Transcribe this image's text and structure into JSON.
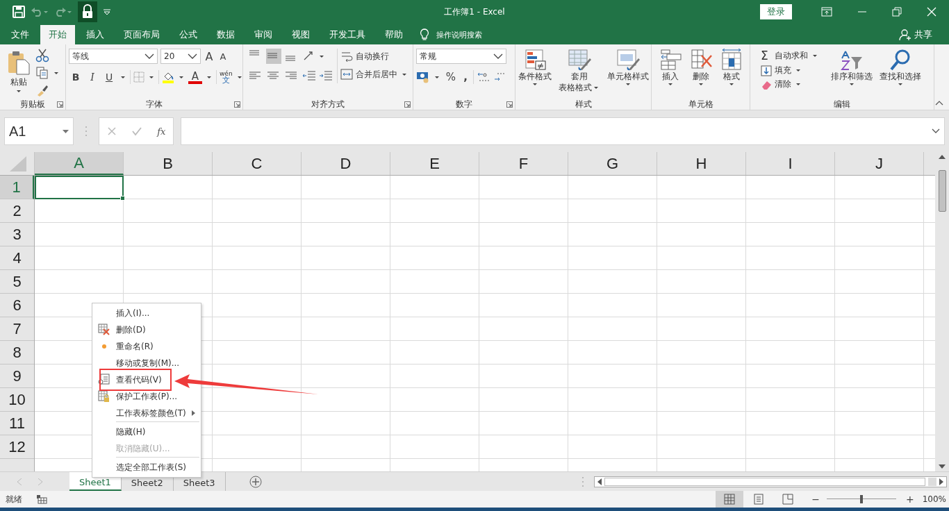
{
  "title_bar": {
    "title": "工作簿1  -  Excel",
    "login_button": "登录"
  },
  "ribbon_tabs": [
    {
      "label": "文件",
      "selected": false
    },
    {
      "label": "开始",
      "selected": true
    },
    {
      "label": "插入",
      "selected": false
    },
    {
      "label": "页面布局",
      "selected": false
    },
    {
      "label": "公式",
      "selected": false
    },
    {
      "label": "数据",
      "selected": false
    },
    {
      "label": "审阅",
      "selected": false
    },
    {
      "label": "视图",
      "selected": false
    },
    {
      "label": "开发工具",
      "selected": false
    },
    {
      "label": "帮助",
      "selected": false
    }
  ],
  "tell_me": "操作说明搜索",
  "share": "共享",
  "ribbon": {
    "clipboard": {
      "paste": "粘贴",
      "label": "剪贴板"
    },
    "font": {
      "font_name": "等线",
      "font_size": "20",
      "grow": "A",
      "shrink": "A",
      "bold": "B",
      "italic": "I",
      "underline": "U",
      "font_color": "A",
      "phonetic_top": "wén",
      "phonetic_bottom": "文",
      "label": "字体"
    },
    "alignment": {
      "vertical_align": [
        {
          "selected": false
        },
        {
          "selected": true
        },
        {
          "selected": false
        }
      ],
      "wrap_text": "自动换行",
      "merge_center": "合并后居中",
      "label": "对齐方式"
    },
    "number": {
      "format": "常规",
      "percent": "%",
      "comma": ",",
      "label": "数字"
    },
    "styles": {
      "buttons": [
        {
          "kind": "conditional",
          "lines": [
            "条件格式"
          ]
        },
        {
          "kind": "table",
          "lines": [
            "套用",
            "表格格式"
          ]
        },
        {
          "kind": "cellstyle",
          "lines": [
            "单元格样式"
          ]
        }
      ],
      "label": "样式"
    },
    "cells": {
      "buttons": [
        {
          "kind": "insert",
          "lines": [
            "插入"
          ]
        },
        {
          "kind": "delete",
          "lines": [
            "删除"
          ]
        },
        {
          "kind": "format",
          "lines": [
            "格式"
          ]
        }
      ],
      "label": "单元格"
    },
    "editing": {
      "sigma": "Σ",
      "autosum": "自动求和",
      "fill": "填充",
      "clear": "清除",
      "sort": "排序和筛选",
      "find": "查找和选择",
      "label": "编辑"
    }
  },
  "formula_bar": {
    "name_box": "A1",
    "fx": "fx"
  },
  "columns": [
    {
      "label": "A",
      "selected": true
    },
    {
      "label": "B",
      "selected": false
    },
    {
      "label": "C",
      "selected": false
    },
    {
      "label": "D",
      "selected": false
    },
    {
      "label": "E",
      "selected": false
    },
    {
      "label": "F",
      "selected": false
    },
    {
      "label": "G",
      "selected": false
    },
    {
      "label": "H",
      "selected": false
    },
    {
      "label": "I",
      "selected": false
    },
    {
      "label": "J",
      "selected": false
    }
  ],
  "rows": [
    {
      "label": "1",
      "selected": true
    },
    {
      "label": "2",
      "selected": false
    },
    {
      "label": "3",
      "selected": false
    },
    {
      "label": "4",
      "selected": false
    },
    {
      "label": "5",
      "selected": false
    },
    {
      "label": "6",
      "selected": false
    },
    {
      "label": "7",
      "selected": false
    },
    {
      "label": "8",
      "selected": false
    },
    {
      "label": "9",
      "selected": false
    },
    {
      "label": "10",
      "selected": false
    },
    {
      "label": "11",
      "selected": false
    },
    {
      "label": "12",
      "selected": false
    }
  ],
  "context_menu": [
    {
      "label": "插入(I)...",
      "kind": "plain",
      "disabled": false,
      "submenu": false,
      "separator_before": false,
      "highlighted": false
    },
    {
      "label": "删除(D)",
      "kind": "delete",
      "disabled": false,
      "submenu": false,
      "separator_before": false,
      "highlighted": false
    },
    {
      "label": "重命名(R)",
      "kind": "rename",
      "disabled": false,
      "submenu": false,
      "separator_before": false,
      "highlighted": false
    },
    {
      "label": "移动或复制(M)...",
      "kind": "plain",
      "disabled": false,
      "submenu": false,
      "separator_before": false,
      "highlighted": false
    },
    {
      "label": "查看代码(V)",
      "kind": "code",
      "disabled": false,
      "submenu": false,
      "separator_before": false,
      "highlighted": true
    },
    {
      "label": "保护工作表(P)...",
      "kind": "protect",
      "disabled": false,
      "submenu": false,
      "separator_before": false,
      "highlighted": false
    },
    {
      "label": "工作表标签颜色(T)",
      "kind": "plain",
      "disabled": false,
      "submenu": true,
      "separator_before": false,
      "highlighted": false
    },
    {
      "label": "隐藏(H)",
      "kind": "plain",
      "disabled": false,
      "submenu": false,
      "separator_before": true,
      "highlighted": false
    },
    {
      "label": "取消隐藏(U)...",
      "kind": "plain",
      "disabled": true,
      "submenu": false,
      "separator_before": false,
      "highlighted": false
    },
    {
      "label": "选定全部工作表(S)",
      "kind": "plain",
      "disabled": false,
      "submenu": false,
      "separator_before": true,
      "highlighted": false
    }
  ],
  "sheet_tabs": [
    {
      "label": "Sheet1",
      "selected": true
    },
    {
      "label": "Sheet2",
      "selected": false
    },
    {
      "label": "Sheet3",
      "selected": false
    }
  ],
  "status_bar": {
    "status": "就绪",
    "views": [
      {
        "selected": true
      },
      {
        "selected": false
      },
      {
        "selected": false
      }
    ],
    "zoom_out": "−",
    "zoom_in": "+",
    "zoom": {
      "level": 0.5,
      "reading": "100%"
    }
  }
}
